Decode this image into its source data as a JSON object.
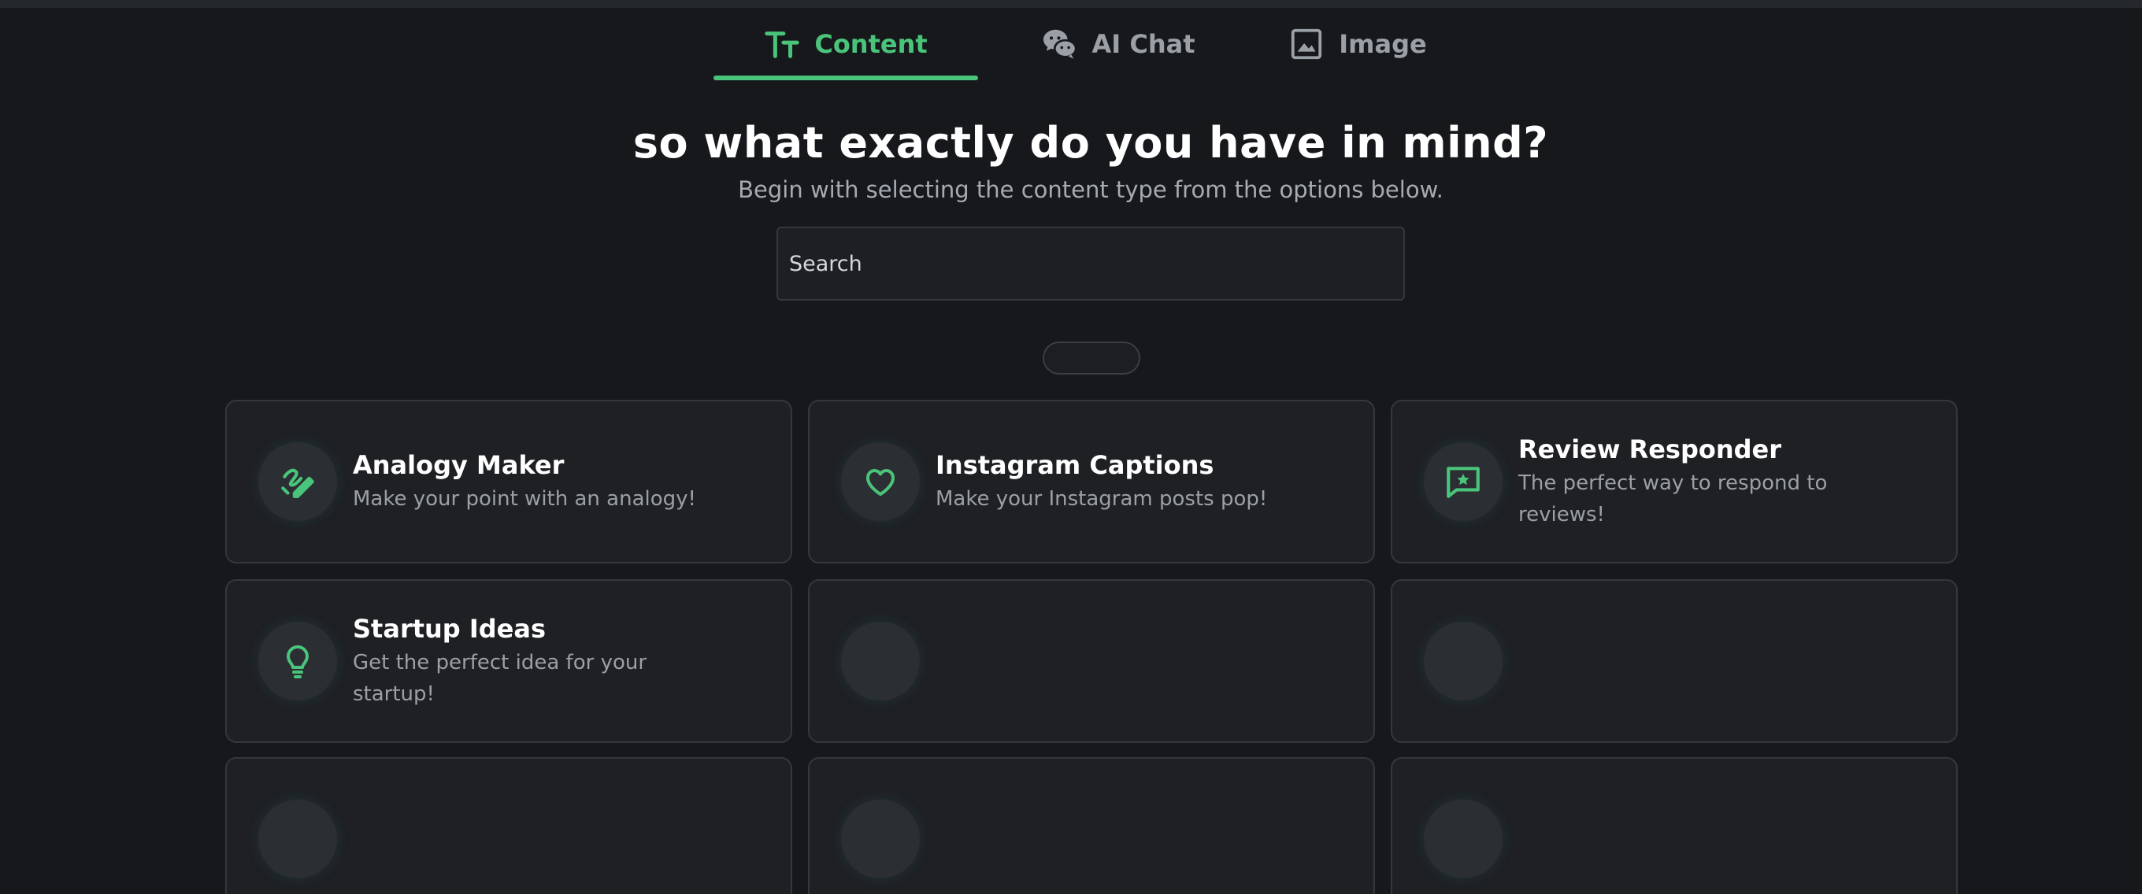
{
  "tabs": [
    {
      "label": "Content",
      "icon": "text-size-icon",
      "active": true
    },
    {
      "label": "AI Chat",
      "icon": "wechat-icon",
      "active": false
    },
    {
      "label": "Image",
      "icon": "image-icon",
      "active": false
    }
  ],
  "heading": {
    "title": "so what exactly do you have in mind?",
    "subtitle": "Begin with selecting the content type from the options below."
  },
  "search": {
    "placeholder": "Search",
    "value": ""
  },
  "cards": [
    {
      "title": "Analogy Maker",
      "description": "Make your point with an analogy!",
      "icon": "pencil-pen-icon"
    },
    {
      "title": "Instagram Captions",
      "description": "Make your Instagram posts pop!",
      "icon": "heart-icon"
    },
    {
      "title": "Review Responder",
      "description": "The perfect way to respond to reviews!",
      "icon": "star-message-icon"
    },
    {
      "title": "Startup Ideas",
      "description": "Get the perfect idea for your startup!",
      "icon": "lightbulb-icon"
    }
  ],
  "colors": {
    "accent": "#4ac47a",
    "background": "#16181c",
    "card": "#1e2024"
  }
}
